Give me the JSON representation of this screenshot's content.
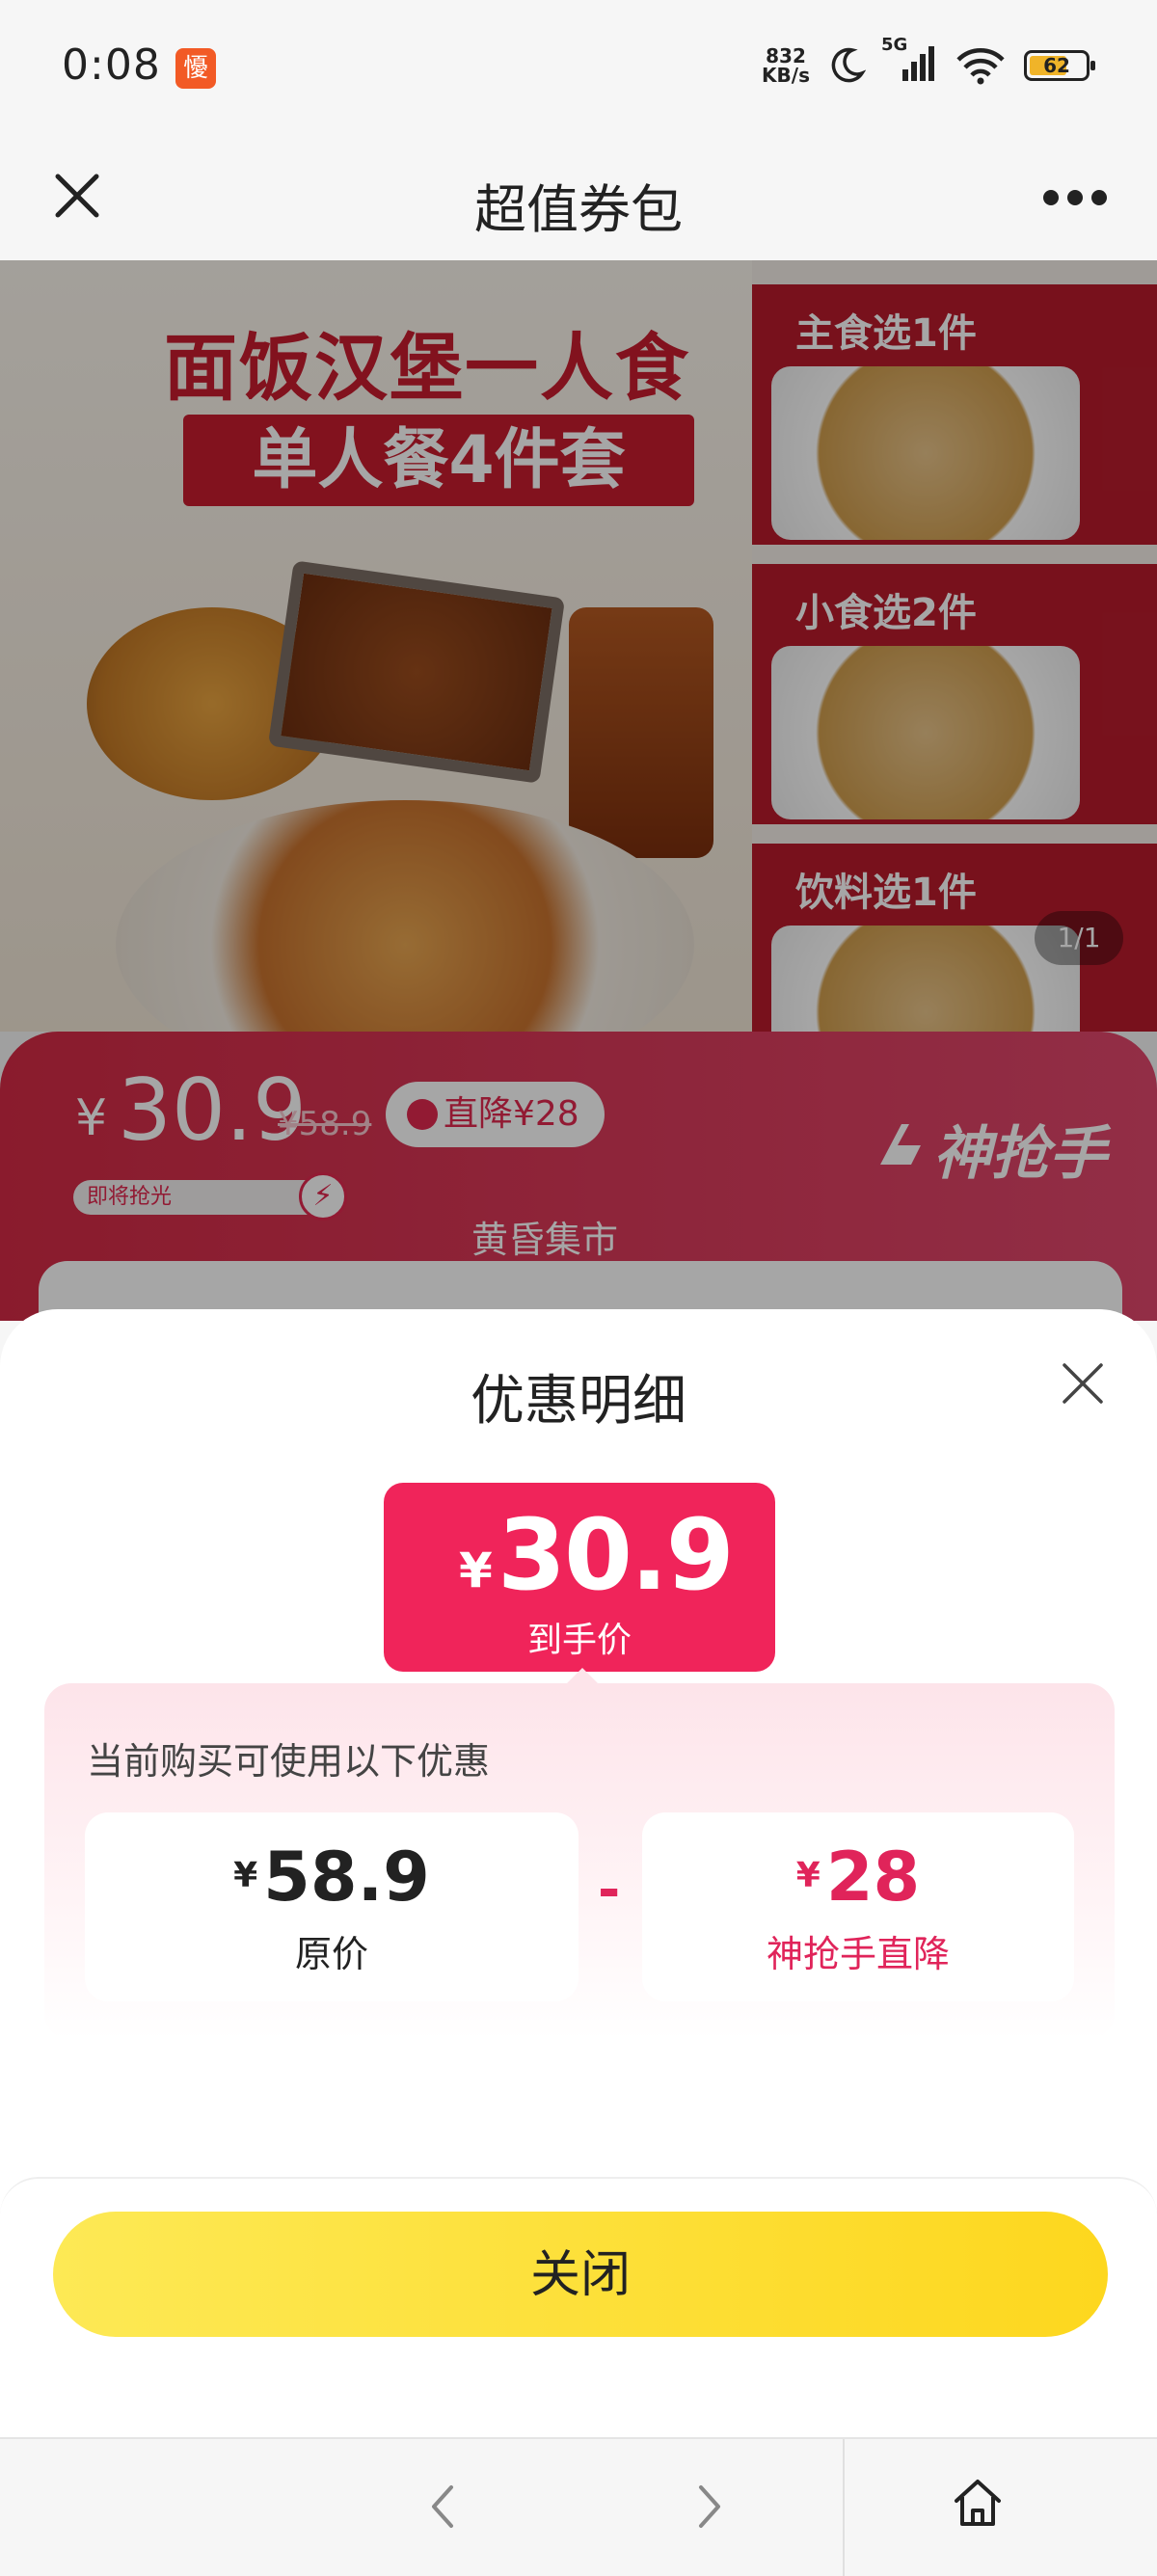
{
  "status_bar": {
    "time": "0:08",
    "app_badge": "懮",
    "net_speed_value": "832",
    "net_speed_unit": "KB/s",
    "network": "5G",
    "battery": "62"
  },
  "header": {
    "title": "超值券包"
  },
  "hero": {
    "headline_1": "面饭汉堡一人食",
    "headline_2": "单人餐4件套",
    "panel_1": "主食选1件",
    "panel_2": "小食选2件",
    "panel_3": "饮料选1件",
    "page_indicator": "1/1"
  },
  "price_strip": {
    "currency": "¥",
    "price": "30.9",
    "original_price": "¥58.9",
    "badge": "直降¥28",
    "progress_text": "即将抢光",
    "brand": "神抢手",
    "shop_name": "黄昏集市"
  },
  "sheet": {
    "title": "优惠明细",
    "final_price": {
      "currency": "¥",
      "amount": "30.9",
      "label": "到手价"
    },
    "discount_heading": "当前购买可使用以下优惠",
    "original": {
      "currency": "¥",
      "amount": "58.9",
      "label": "原价"
    },
    "operator": "-",
    "discount": {
      "currency": "¥",
      "amount": "28",
      "label": "神抢手直降"
    },
    "close_button": "关闭"
  },
  "colors": {
    "accent_pink": "#f0245a",
    "button_yellow": "#fdd71e"
  }
}
